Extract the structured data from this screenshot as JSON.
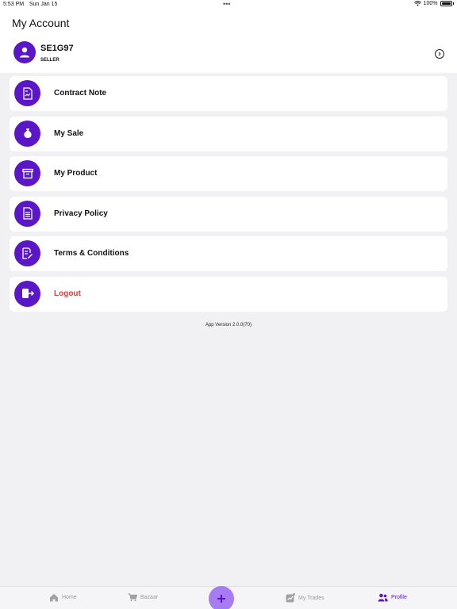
{
  "status_bar": {
    "time": "5:53 PM",
    "date": "Sun Jan 15",
    "battery": "100%"
  },
  "header": {
    "title": "My Account"
  },
  "profile": {
    "username": "SE1G97",
    "role": "SELLER"
  },
  "menu": {
    "items": [
      {
        "label": "Contract Note",
        "icon": "contract-note-icon"
      },
      {
        "label": "My Sale",
        "icon": "money-bag-icon"
      },
      {
        "label": "My Product",
        "icon": "archive-box-icon"
      },
      {
        "label": "Privacy Policy",
        "icon": "document-icon"
      },
      {
        "label": "Terms & Conditions",
        "icon": "edit-document-icon"
      },
      {
        "label": "Logout",
        "icon": "logout-icon"
      }
    ]
  },
  "footer": {
    "version": "App Version 2.0.0(70)"
  },
  "tab_bar": {
    "tabs": [
      {
        "label": "Home",
        "icon": "home-icon"
      },
      {
        "label": "Bazaar",
        "icon": "cart-icon"
      },
      {
        "label": "My Trades",
        "icon": "trades-chart-icon"
      },
      {
        "label": "Profile",
        "icon": "profile-icon"
      }
    ],
    "fab_icon": "plus-icon"
  },
  "colors": {
    "accent": "#5b17c7",
    "fab": "#a77cf2",
    "logout": "#e53935",
    "background": "#f1f1f3"
  }
}
